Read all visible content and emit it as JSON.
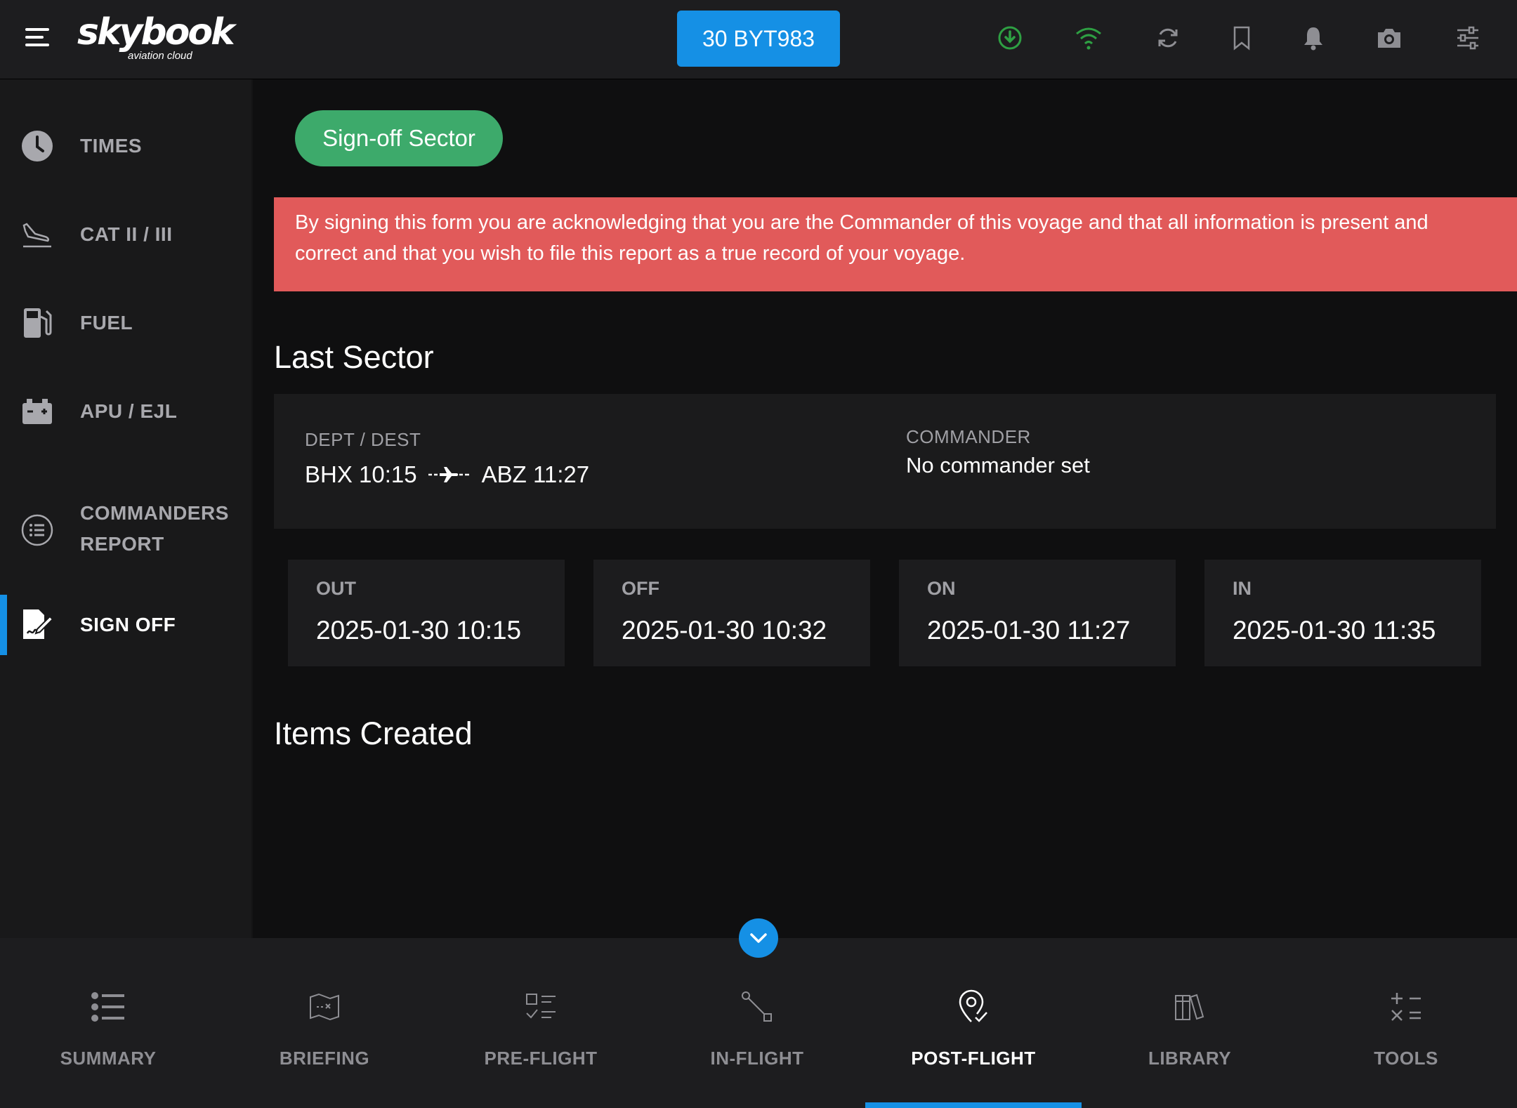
{
  "app": {
    "logo_text": "skybook",
    "logo_subtext": "aviation cloud",
    "flight_number": "30 BYT983"
  },
  "colors": {
    "accent": "#1590e5",
    "success": "#3daa6b",
    "warning": "#e15a5a",
    "online": "#2ea043"
  },
  "topbar_icons": [
    "download-icon",
    "wifi-icon",
    "sync-icon",
    "bookmark-icon",
    "bell-icon",
    "camera-icon",
    "settings-sliders-icon"
  ],
  "sidebar": {
    "items": [
      {
        "label": "TIMES",
        "icon": "clock-icon"
      },
      {
        "label": "CAT II / III",
        "icon": "plane-landing-icon"
      },
      {
        "label": "FUEL",
        "icon": "fuel-pump-icon"
      },
      {
        "label": "APU / EJL",
        "icon": "battery-icon"
      },
      {
        "label": "COMMANDERS REPORT",
        "label_line1": "COMMANDERS",
        "label_line2": "REPORT",
        "icon": "list-circle-icon"
      },
      {
        "label": "SIGN OFF",
        "icon": "sign-document-icon",
        "active": true
      }
    ]
  },
  "main": {
    "signoff_button": "Sign-off Sector",
    "warning_text": "By signing this form you are acknowledging that you are the Commander of this voyage and that all information is present and correct and that you wish to file this report as a true record of your voyage.",
    "last_sector_heading": "Last Sector",
    "sector": {
      "route_label": "DEPT / DEST",
      "dept": "BHX 10:15",
      "dest": "ABZ 11:27",
      "commander_label": "COMMANDER",
      "commander_value": "No commander set"
    },
    "times": [
      {
        "label": "OUT",
        "value": "2025-01-30 10:15"
      },
      {
        "label": "OFF",
        "value": "2025-01-30 10:32"
      },
      {
        "label": "ON",
        "value": "2025-01-30 11:27"
      },
      {
        "label": "IN",
        "value": "2025-01-30 11:35"
      }
    ],
    "items_created_heading": "Items Created"
  },
  "bottom_nav": [
    {
      "label": "SUMMARY",
      "icon": "list-icon"
    },
    {
      "label": "BRIEFING",
      "icon": "map-icon"
    },
    {
      "label": "PRE-FLIGHT",
      "icon": "checklist-icon"
    },
    {
      "label": "IN-FLIGHT",
      "icon": "route-icon"
    },
    {
      "label": "POST-FLIGHT",
      "icon": "location-check-icon",
      "active": true
    },
    {
      "label": "LIBRARY",
      "icon": "books-icon"
    },
    {
      "label": "TOOLS",
      "icon": "calculator-icon"
    }
  ]
}
